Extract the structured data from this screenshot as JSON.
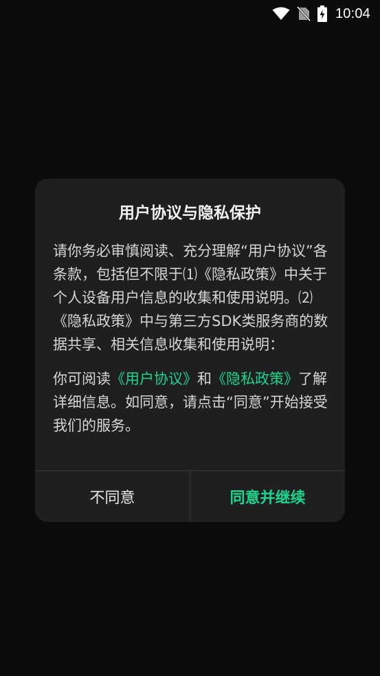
{
  "status_bar": {
    "time": "10:04",
    "icons": [
      "wifi-icon",
      "no-sim-icon",
      "battery-charging-icon"
    ]
  },
  "dialog": {
    "title": "用户协议与隐私保护",
    "paragraph1": "请你务必审慎阅读、充分理解“用户协议”各条款，包括但不限于⑴《隐私政策》中关于个人设备用户信息的收集和使用说明。⑵《隐私政策》中与第三方SDK类服务商的数据共享、相关信息收集和使用说明：",
    "paragraph2": {
      "prefix": "你可阅读",
      "link_user_agreement": "《用户协议》",
      "and": "和",
      "link_privacy_policy": "《隐私政策》",
      "suffix": "了解详细信息。如同意，请点击“同意”开始接受我们的服务。"
    },
    "buttons": {
      "disagree": "不同意",
      "agree": "同意并继续"
    }
  },
  "colors": {
    "background": "#0b0b0c",
    "dialog_bg": "#1f1f22",
    "accent": "#19d68c"
  }
}
